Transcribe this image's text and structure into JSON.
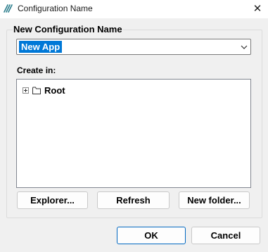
{
  "window": {
    "title": "Configuration Name",
    "close_glyph": "✕",
    "app_icon": "app-logo-icon"
  },
  "group": {
    "title": "New Configuration Name",
    "name_value": "New App"
  },
  "create_in": {
    "label": "Create in:",
    "tree": [
      {
        "label": "Root",
        "icon": "folder-icon",
        "expander": "plus"
      }
    ]
  },
  "buttons": {
    "explorer": "Explorer...",
    "refresh": "Refresh",
    "new_folder": "New folder...",
    "ok": "OK",
    "cancel": "Cancel"
  },
  "colors": {
    "selection": "#0078d7",
    "default_button_border": "#0067c0",
    "window_bg": "#f0f0f0"
  }
}
